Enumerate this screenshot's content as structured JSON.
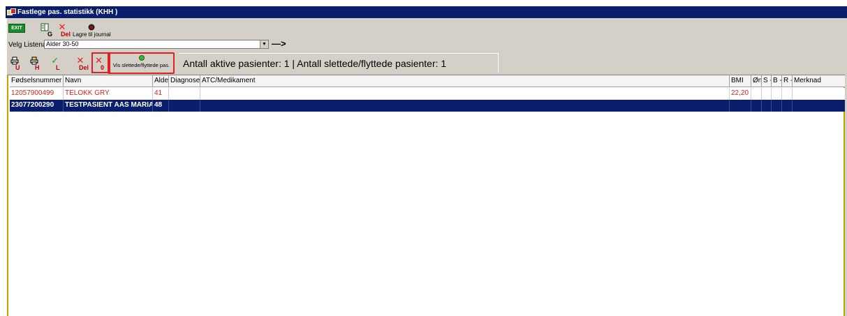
{
  "window": {
    "title": "Fastlege pas. statistikk (KHH )"
  },
  "toolbar1": {
    "exit_label": "EXIT",
    "g_label": "G",
    "del_label": "Del",
    "journal_label": "Lagre til journal"
  },
  "list": {
    "label": "Velg Listenavn:",
    "selected": "Alder 30-50",
    "arrow": "—>"
  },
  "toolbar2": {
    "u_label": "U",
    "h_label": "H",
    "l_label": "L",
    "del_label": "Del",
    "zero_label": "0",
    "vis_label": "Vis slettede/flyttede pas."
  },
  "status": {
    "counts_text": "Antall aktive pasienter: 1 | Antall slettede/flyttede pasienter: 1"
  },
  "table": {
    "columns": [
      "Fødselsnummer",
      "Navn",
      "Alde",
      "Diagnose",
      "ATC/Medikament",
      "BMI",
      "Øn",
      "S -",
      "B -",
      "R -",
      "Merknad"
    ],
    "rows": [
      {
        "fnr": "12057900499",
        "navn": "TELOKK GRY",
        "alder": "41",
        "diagnose": "",
        "atc": "",
        "bmi": "22,20",
        "on": "",
        "s": "",
        "b": "",
        "r": "",
        "merknad": ""
      },
      {
        "fnr": "23077200290",
        "navn": "TESTPASIENT AAS MARIA",
        "alder": "48",
        "diagnose": "",
        "atc": "",
        "bmi": "",
        "on": "",
        "s": "",
        "b": "",
        "r": "",
        "merknad": ""
      }
    ]
  },
  "colors": {
    "title_bar": "#0a1e6e",
    "selected_row": "#0a1e6e",
    "deleted_row_text": "#e02020",
    "highlight_box": "#e02020"
  }
}
